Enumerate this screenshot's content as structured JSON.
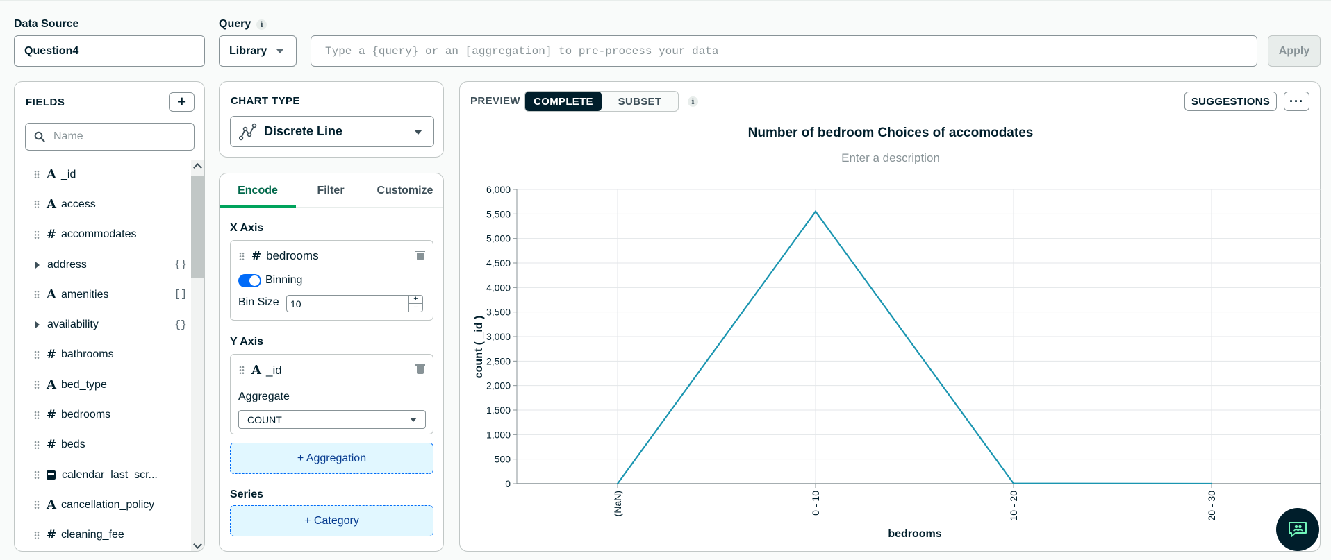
{
  "data_source": {
    "label": "Data Source",
    "value": "Question4"
  },
  "query": {
    "label": "Query",
    "info_icon": "info-icon",
    "library_label": "Library",
    "placeholder": "Type a {query} or an [aggregation] to pre-process your data",
    "apply_label": "Apply"
  },
  "fields": {
    "title": "FIELDS",
    "add_label": "+",
    "search_placeholder": "Name",
    "items": [
      {
        "name": "_id",
        "type": "A",
        "expandable": false,
        "suffix": ""
      },
      {
        "name": "access",
        "type": "A",
        "expandable": false,
        "suffix": ""
      },
      {
        "name": "accommodates",
        "type": "#",
        "expandable": false,
        "suffix": ""
      },
      {
        "name": "address",
        "type": "",
        "expandable": true,
        "suffix": "{}"
      },
      {
        "name": "amenities",
        "type": "A",
        "expandable": false,
        "suffix": "[]"
      },
      {
        "name": "availability",
        "type": "",
        "expandable": true,
        "suffix": "{}"
      },
      {
        "name": "bathrooms",
        "type": "#",
        "expandable": false,
        "suffix": ""
      },
      {
        "name": "bed_type",
        "type": "A",
        "expandable": false,
        "suffix": ""
      },
      {
        "name": "bedrooms",
        "type": "#",
        "expandable": false,
        "suffix": ""
      },
      {
        "name": "beds",
        "type": "#",
        "expandable": false,
        "suffix": ""
      },
      {
        "name": "calendar_last_scr...",
        "type": "date",
        "expandable": false,
        "suffix": ""
      },
      {
        "name": "cancellation_policy",
        "type": "A",
        "expandable": false,
        "suffix": ""
      },
      {
        "name": "cleaning_fee",
        "type": "#",
        "expandable": false,
        "suffix": ""
      }
    ]
  },
  "chart_type": {
    "title": "CHART TYPE",
    "value": "Discrete Line"
  },
  "encode": {
    "tabs": [
      "Encode",
      "Filter",
      "Customize"
    ],
    "active_tab": "Encode",
    "x_axis": {
      "title": "X Axis",
      "field": "bedrooms",
      "type": "#",
      "binning_label": "Binning",
      "binning_on": true,
      "bin_size_label": "Bin Size",
      "bin_size": "10",
      "plus": "+",
      "minus": "−"
    },
    "y_axis": {
      "title": "Y Axis",
      "field": "_id",
      "type": "A",
      "aggregate_label": "Aggregate",
      "aggregate_value": "COUNT"
    },
    "aggregation_btn": "+ Aggregation",
    "series_title": "Series",
    "category_btn": "+ Category"
  },
  "preview": {
    "label": "PREVIEW",
    "segments": [
      "COMPLETE",
      "SUBSET"
    ],
    "active_segment": "COMPLETE",
    "suggestions_label": "SUGGESTIONS",
    "more_label": "···",
    "description_placeholder": "Enter a description",
    "accent_color": "#1a95b0"
  },
  "chart_data": {
    "type": "line",
    "title": "Number of bedroom Choices  of accomodates",
    "xlabel": "bedrooms",
    "ylabel": "count ( _id )",
    "categories": [
      "(NaN)",
      "0 - 10",
      "10 - 20",
      "20 - 30"
    ],
    "values": [
      0,
      5550,
      5,
      1
    ],
    "ylim": [
      0,
      6000
    ],
    "yticks": [
      "0",
      "500",
      "1,000",
      "1,500",
      "2,000",
      "2,500",
      "3,000",
      "3,500",
      "4,000",
      "4,500",
      "5,000",
      "5,500",
      "6,000"
    ],
    "grid": true,
    "color": "#1a95b0"
  }
}
